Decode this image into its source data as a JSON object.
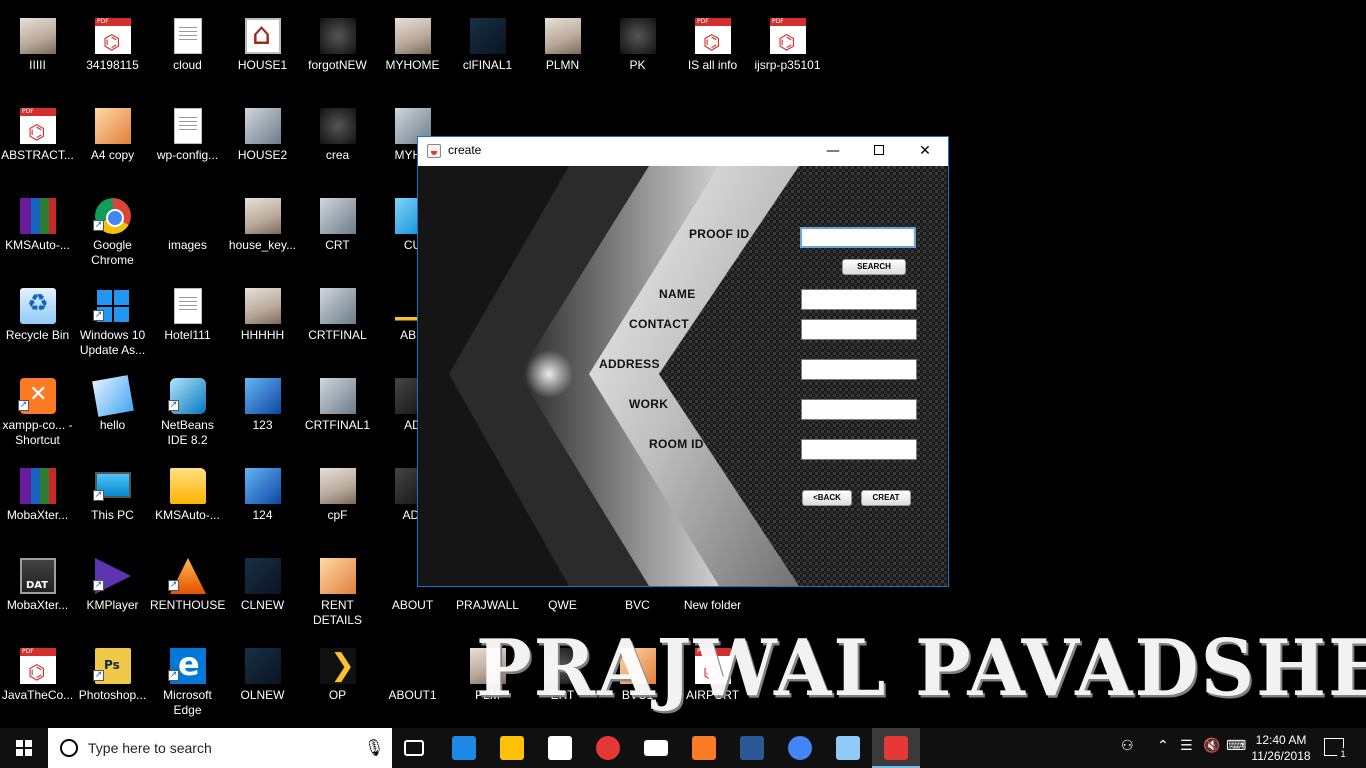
{
  "desktop": {
    "icons": [
      {
        "label": "IIIII",
        "kind": "t-img2"
      },
      {
        "label": "34198115",
        "kind": "t-pdf"
      },
      {
        "label": "cloud",
        "kind": "t-doc"
      },
      {
        "label": "HOUSE1",
        "kind": "t-house"
      },
      {
        "label": "forgotNEW",
        "kind": "t-dark"
      },
      {
        "label": "MYHOME",
        "kind": "t-img2"
      },
      {
        "label": "clFINAL1",
        "kind": "t-img3"
      },
      {
        "label": "PLMN",
        "kind": "t-img2"
      },
      {
        "label": "PK",
        "kind": "t-dark"
      },
      {
        "label": "IS all info",
        "kind": "t-pdf"
      },
      {
        "label": "ijsrp-p35101",
        "kind": "t-pdf"
      },
      {
        "label": "ABSTRACT...",
        "kind": "t-pdf"
      },
      {
        "label": "A4 copy",
        "kind": "t-img5"
      },
      {
        "label": "wp-config...",
        "kind": "t-doc"
      },
      {
        "label": "HOUSE2",
        "kind": "t-img"
      },
      {
        "label": "crea",
        "kind": "t-dark"
      },
      {
        "label": "MYHO",
        "kind": "t-img"
      },
      {
        "label": "KMSAuto-...",
        "kind": "t-rar"
      },
      {
        "label": "Google Chrome",
        "kind": "t-chrome"
      },
      {
        "label": "images",
        "kind": "t-blank"
      },
      {
        "label": "house_key...",
        "kind": "t-img2"
      },
      {
        "label": "CRT",
        "kind": "t-img"
      },
      {
        "label": "CU",
        "kind": "t-cu"
      },
      {
        "label": "Recycle Bin",
        "kind": "t-recycle"
      },
      {
        "label": "Windows 10 Update As...",
        "kind": "t-win"
      },
      {
        "label": "Hotel111",
        "kind": "t-doc"
      },
      {
        "label": "HHHHH",
        "kind": "t-img2"
      },
      {
        "label": "CRTFINAL",
        "kind": "t-img"
      },
      {
        "label": "ABR",
        "kind": "t-abr"
      },
      {
        "label": "xampp-co... - Shortcut",
        "kind": "t-xampp"
      },
      {
        "label": "hello",
        "kind": "t-hello"
      },
      {
        "label": "NetBeans IDE 8.2",
        "kind": "t-nb"
      },
      {
        "label": "123",
        "kind": "t-img4"
      },
      {
        "label": "CRTFINAL1",
        "kind": "t-img"
      },
      {
        "label": "AD",
        "kind": "t-ad"
      },
      {
        "label": "MobaXter...",
        "kind": "t-rar"
      },
      {
        "label": "This PC",
        "kind": "t-pc"
      },
      {
        "label": "KMSAuto-...",
        "kind": "t-folder"
      },
      {
        "label": "124",
        "kind": "t-img4"
      },
      {
        "label": "cpF",
        "kind": "t-img2"
      },
      {
        "label": "ADI",
        "kind": "t-ad"
      },
      {
        "label": "MobaXter...",
        "kind": "t-dat"
      },
      {
        "label": "KMPlayer",
        "kind": "t-kmp"
      },
      {
        "label": "RENTHOUSE",
        "kind": "t-rent"
      },
      {
        "label": "CLNEW",
        "kind": "t-img3"
      },
      {
        "label": "RENT DETAILS",
        "kind": "t-img5"
      },
      {
        "label": "ABOUT",
        "kind": "t-blank"
      },
      {
        "label": "PRAJWALL",
        "kind": "t-blank"
      },
      {
        "label": "QWE",
        "kind": "t-blank"
      },
      {
        "label": "BVC",
        "kind": "t-blank"
      },
      {
        "label": "New folder",
        "kind": "t-blank"
      },
      {
        "label": "JavaTheCo...",
        "kind": "t-pdf"
      },
      {
        "label": "Photoshop...",
        "kind": "t-ps"
      },
      {
        "label": "Microsoft Edge",
        "kind": "t-edge"
      },
      {
        "label": "OLNEW",
        "kind": "t-img3"
      },
      {
        "label": "OP",
        "kind": "t-op"
      },
      {
        "label": "ABOUT1",
        "kind": "t-blank"
      },
      {
        "label": "PLM",
        "kind": "t-img2"
      },
      {
        "label": "ERT",
        "kind": "t-dark"
      },
      {
        "label": "BVC1",
        "kind": "t-img5"
      },
      {
        "label": "AIRPORT",
        "kind": "t-pdf"
      }
    ],
    "watermark": "PRAJWAL PAVADSHETTY"
  },
  "window": {
    "title": "create",
    "controls": {
      "minimize": "—",
      "close": "✕"
    },
    "form": {
      "proof_id_label": "PROOF ID",
      "proof_id_value": "",
      "search_label": "SEARCH",
      "name_label": "NAME",
      "name_value": "",
      "contact_label": "CONTACT",
      "contact_value": "",
      "address_label": "ADDRESS",
      "address_value": "",
      "work_label": "WORK",
      "work_value": "",
      "room_id_label": "ROOM ID",
      "room_id_value": "",
      "back_label": "<BACK",
      "create_label": "CREAT"
    }
  },
  "taskbar": {
    "search_placeholder": "Type here to search",
    "apps": [
      {
        "name": "task-view",
        "color": "#ffffff"
      },
      {
        "name": "edge",
        "color": "#1e88e5"
      },
      {
        "name": "file-explorer",
        "color": "#ffc107"
      },
      {
        "name": "store",
        "color": "#ffffff"
      },
      {
        "name": "opera",
        "color": "#e53935"
      },
      {
        "name": "mail",
        "color": "#ffffff"
      },
      {
        "name": "xampp",
        "color": "#fb7a24"
      },
      {
        "name": "word",
        "color": "#2b5797"
      },
      {
        "name": "chrome",
        "color": "#4285f4"
      },
      {
        "name": "netbeans",
        "color": "#90caf9"
      },
      {
        "name": "java",
        "color": "#e53935"
      }
    ],
    "time": "12:40 AM",
    "date": "11/26/2018",
    "notifications_count": "1"
  },
  "colors": {
    "window_border": "#1a73c7",
    "taskbar": "#101010",
    "active_indicator": "#76b9ed"
  }
}
